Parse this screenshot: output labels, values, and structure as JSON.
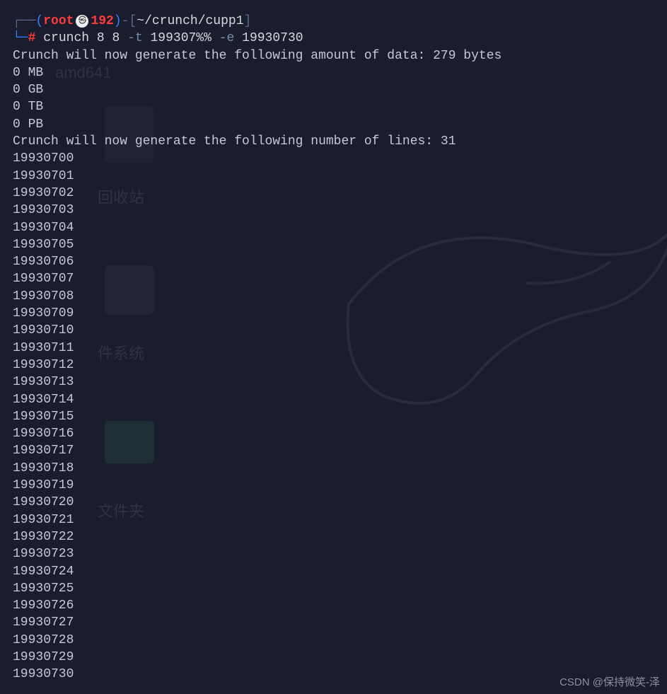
{
  "prompt": {
    "corner_top": "┌──",
    "paren_open": "(",
    "user": "root",
    "host": "192",
    "paren_close": ")",
    "dash": "-",
    "bracket_open": "[",
    "path": "~/crunch/cupp1",
    "bracket_close": "]",
    "corner_bot": "└─",
    "hash": "#"
  },
  "command": {
    "cmd": "crunch",
    "args1": "8 8",
    "flag1": "-t",
    "args2": "199307%%",
    "flag2": "-e",
    "args3": "19930730"
  },
  "output": {
    "line1": "Crunch will now generate the following amount of data: 279 bytes",
    "line2": "0 MB",
    "line3": "0 GB",
    "line4": "0 TB",
    "line5": "0 PB",
    "line6": "Crunch will now generate the following number of lines: 31",
    "numbers": [
      "19930700",
      "19930701",
      "19930702",
      "19930703",
      "19930704",
      "19930705",
      "19930706",
      "19930707",
      "19930708",
      "19930709",
      "19930710",
      "19930711",
      "19930712",
      "19930713",
      "19930714",
      "19930715",
      "19930716",
      "19930717",
      "19930718",
      "19930719",
      "19930720",
      "19930721",
      "19930722",
      "19930723",
      "19930724",
      "19930725",
      "19930726",
      "19930727",
      "19930728",
      "19930729",
      "19930730"
    ]
  },
  "background": {
    "label1": "amd641",
    "label2": "回收站",
    "label3": "件系统",
    "label4": "文件夹"
  },
  "watermark": "CSDN @保持微笑-泽"
}
